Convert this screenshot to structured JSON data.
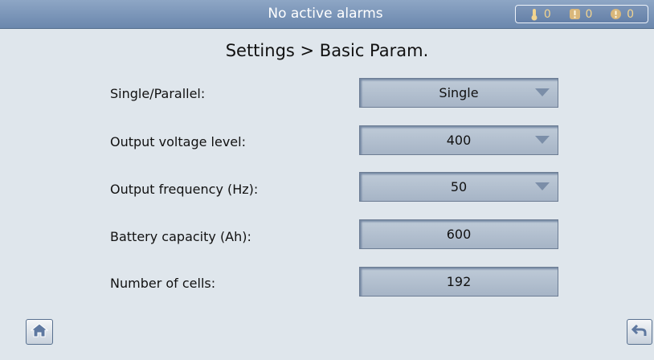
{
  "header": {
    "alarm_status": "No active alarms",
    "counts": {
      "critical": "0",
      "major": "0",
      "minor": "0"
    }
  },
  "page_title": "Settings > Basic Param.",
  "params": [
    {
      "label": "Single/Parallel:",
      "value": "Single",
      "dropdown": true
    },
    {
      "label": "Output voltage level:",
      "value": "400",
      "dropdown": true
    },
    {
      "label": "Output frequency (Hz):",
      "value": "50",
      "dropdown": true
    },
    {
      "label": "Battery capacity (Ah):",
      "value": "600",
      "dropdown": false
    },
    {
      "label": "Number of cells:",
      "value": "192",
      "dropdown": false
    }
  ],
  "icons": {
    "home": "home-icon",
    "back": "back-arrow-icon"
  },
  "colors": {
    "header": "#7892b6",
    "field": "#b4c1d1",
    "alarm_count": "#f2d48f"
  }
}
